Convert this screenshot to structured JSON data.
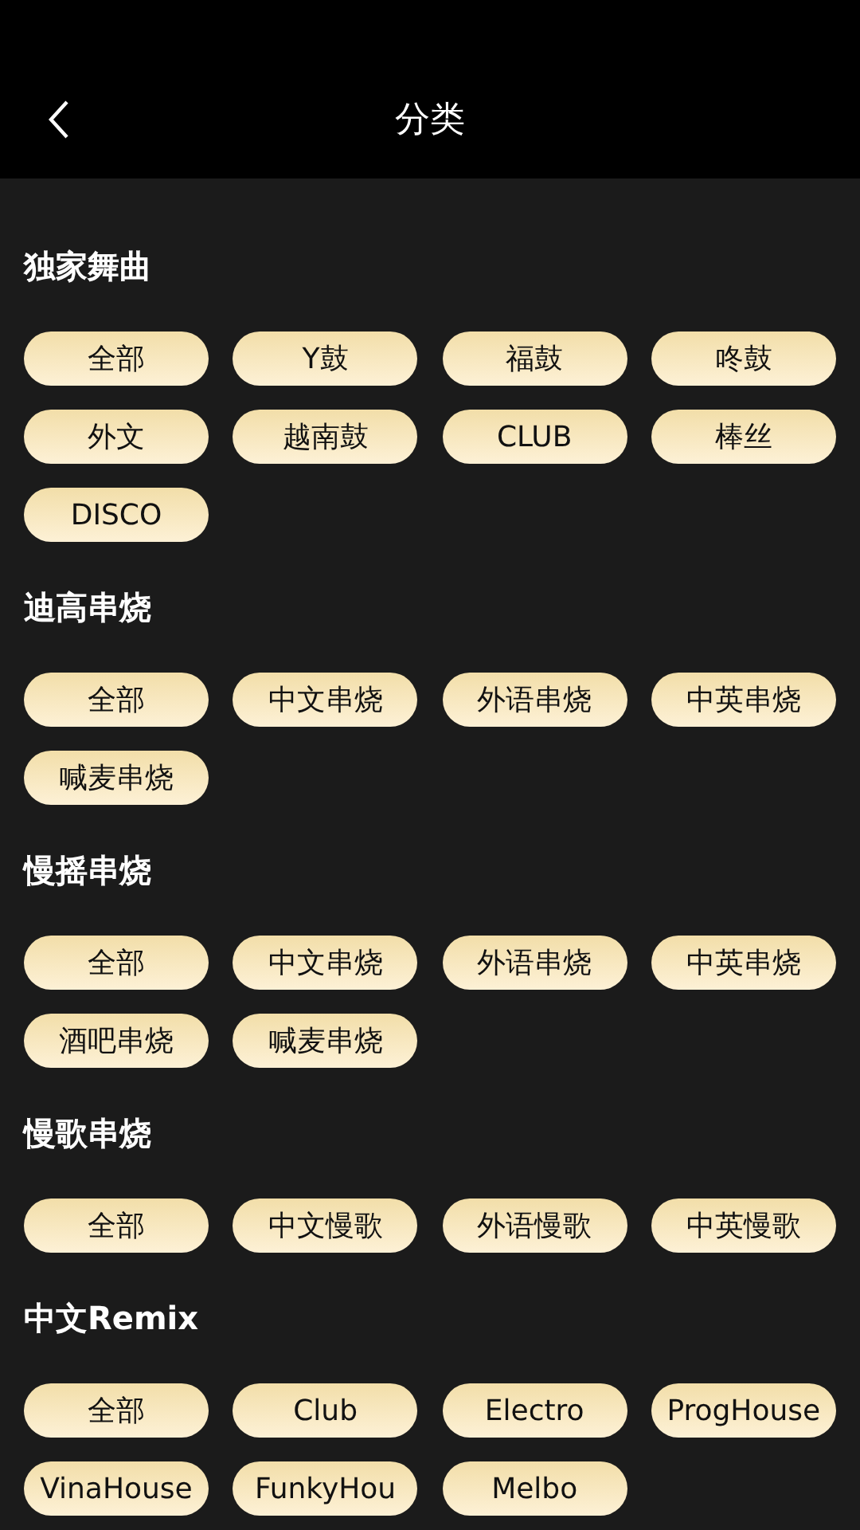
{
  "header": {
    "title": "分类"
  },
  "sections": [
    {
      "title": "独家舞曲",
      "tags": [
        "全部",
        "Y鼓",
        "福鼓",
        "咚鼓",
        "外文",
        "越南鼓",
        "CLUB",
        "棒丝",
        "DISCO"
      ]
    },
    {
      "title": "迪高串烧",
      "tags": [
        "全部",
        "中文串烧",
        "外语串烧",
        "中英串烧",
        "喊麦串烧"
      ]
    },
    {
      "title": "慢摇串烧",
      "tags": [
        "全部",
        "中文串烧",
        "外语串烧",
        "中英串烧",
        "酒吧串烧",
        "喊麦串烧"
      ]
    },
    {
      "title": "慢歌串烧",
      "tags": [
        "全部",
        "中文慢歌",
        "外语慢歌",
        "中英慢歌"
      ]
    },
    {
      "title": "中文Remix",
      "tags": [
        "全部",
        "Club",
        "Electro",
        "ProgHouse",
        "VinaHouse",
        "FunkyHou",
        "Melbo"
      ]
    }
  ]
}
